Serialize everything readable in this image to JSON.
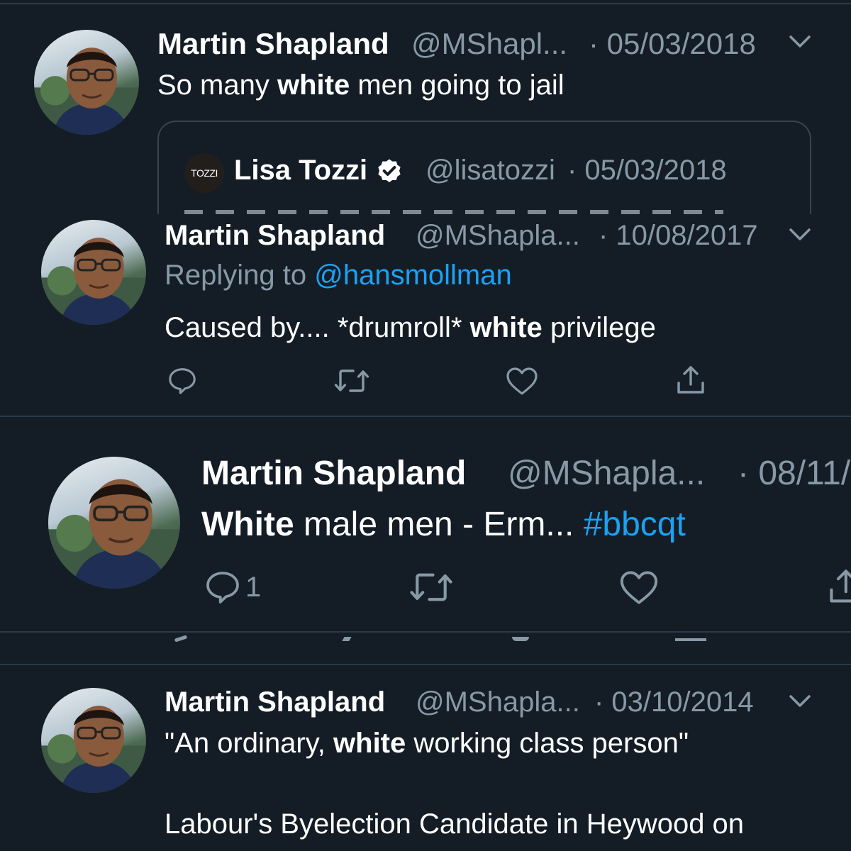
{
  "tweets": [
    {
      "name": "Martin Shapland",
      "handle": "@MShapl...",
      "date": "· 05/03/2018",
      "text_before": "So many ",
      "text_bold": "white",
      "text_after": " men going to jail",
      "quote": {
        "avatar_text": "TOZZI",
        "name": "Lisa Tozzi",
        "handle": "@lisatozzi",
        "date": "· 05/03/2018"
      }
    },
    {
      "name": "Martin Shapland",
      "handle": "@MShapla...",
      "date": "· 10/08/2017",
      "replying_prefix": "Replying to ",
      "replying_handle": "@hansmollman",
      "text_before": "Caused by.... *drumroll* ",
      "text_bold": "white",
      "text_after": " privilege"
    },
    {
      "name": "Martin Shapland",
      "handle": "@MShapla...",
      "date": "· 08/11/",
      "text_bold": "White",
      "text_after": " male men - Erm... ",
      "hashtag": "#bbcqt",
      "reply_count": "1"
    },
    {
      "name": "Martin Shapland",
      "handle": "@MShapla...",
      "date": "· 03/10/2014",
      "text_before": "\"An ordinary, ",
      "text_bold": "white",
      "text_after": " working class person\"",
      "text_line2": "Labour's Byelection Candidate in Heywood on"
    }
  ],
  "icons": {
    "reply": "speech-bubble-icon",
    "retweet": "retweet-arrows-icon",
    "like": "heart-icon",
    "share": "share-upload-icon",
    "menu": "chevron-down-icon",
    "verified": "verified-badge-icon"
  },
  "colors": {
    "background": "#141d26",
    "text": "#ffffff",
    "muted": "#8899a6",
    "link": "#1da1f2",
    "divider": "#2c3a47"
  }
}
